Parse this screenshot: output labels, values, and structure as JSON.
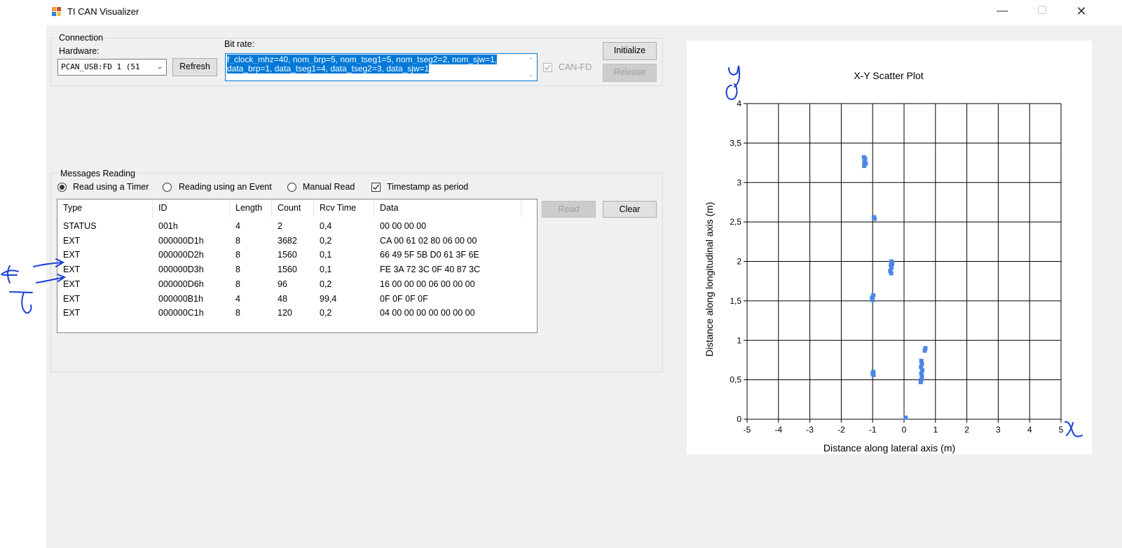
{
  "window": {
    "title": "TI CAN Visualizer"
  },
  "connection": {
    "group_title": "Connection",
    "hardware_label": "Hardware:",
    "hardware_value": "PCAN_USB:FD 1 (51",
    "refresh_label": "Refresh",
    "bitrate_label": "Bit rate:",
    "bitrate_line1": "f_clock_mhz=40, nom_brp=5, nom_tseg1=5, nom_tseg2=2, nom_sjw=1,",
    "bitrate_line2": "data_brp=1, data_tseg1=4, data_tseg2=3, data_sjw=1",
    "canfd_label": "CAN-FD",
    "canfd_checked": true,
    "initialize_label": "Initialize",
    "release_label": "Release"
  },
  "messages": {
    "group_title": "Messages Reading",
    "radio_timer": "Read using a Timer",
    "radio_event": "Reading using an Event",
    "radio_manual": "Manual Read",
    "selected_mode": "timer",
    "timestamp_label": "Timestamp as period",
    "timestamp_checked": true,
    "read_label": "Read",
    "clear_label": "Clear",
    "columns": [
      "Type",
      "ID",
      "Length",
      "Count",
      "Rcv Time",
      "Data"
    ],
    "rows": [
      [
        "STATUS",
        "001h",
        "4",
        "2",
        "0,4",
        "00 00 00 00"
      ],
      [
        "EXT",
        "000000D1h",
        "8",
        "3682",
        "0,2",
        "CA 00 61 02 80 06 00 00"
      ],
      [
        "EXT",
        "000000D2h",
        "8",
        "1560",
        "0,1",
        "66 49 5F 5B D0 61 3F 6E"
      ],
      [
        "EXT",
        "000000D3h",
        "8",
        "1560",
        "0,1",
        "FE 3A 72 3C 0F 40 87 3C"
      ],
      [
        "EXT",
        "000000D6h",
        "8",
        "96",
        "0,2",
        "16 00 00 00 06 00 00 00"
      ],
      [
        "EXT",
        "000000B1h",
        "4",
        "48",
        "99,4",
        "0F 0F 0F 0F"
      ],
      [
        "EXT",
        "000000C1h",
        "8",
        "120",
        "0,2",
        "04 00 00 00 00 00 00 00"
      ]
    ]
  },
  "chart_data": {
    "type": "scatter",
    "title": "X-Y Scatter Plot",
    "xlabel": "Distance along lateral axis (m)",
    "ylabel": "Distance along longitudinal axis (m)",
    "xlim": [
      -5,
      5
    ],
    "ylim": [
      0,
      4
    ],
    "xticks": [
      "-5",
      "-4",
      "-3",
      "-2",
      "-1",
      "0",
      "1",
      "2",
      "3",
      "4",
      "5"
    ],
    "yticks": [
      "0",
      "0,5",
      "1",
      "1,5",
      "2",
      "2,5",
      "3",
      "3,5",
      "4"
    ],
    "grid": true,
    "marker_color": "#4a86e8",
    "points": [
      [
        -1.28,
        3.32
      ],
      [
        -1.24,
        3.3
      ],
      [
        -1.26,
        3.26
      ],
      [
        -1.22,
        3.24
      ],
      [
        -1.27,
        3.21
      ],
      [
        -0.96,
        2.56
      ],
      [
        -0.94,
        2.54
      ],
      [
        -0.4,
        2.0
      ],
      [
        -0.38,
        1.97
      ],
      [
        -0.42,
        1.95
      ],
      [
        -0.4,
        1.92
      ],
      [
        -0.44,
        1.88
      ],
      [
        -0.41,
        1.85
      ],
      [
        -0.98,
        1.57
      ],
      [
        -1.02,
        1.54
      ],
      [
        -1.0,
        1.51
      ],
      [
        -0.98,
        0.6
      ],
      [
        -1.0,
        0.58
      ],
      [
        -0.97,
        0.56
      ],
      [
        0.68,
        0.9
      ],
      [
        0.66,
        0.87
      ],
      [
        0.55,
        0.74
      ],
      [
        0.57,
        0.7
      ],
      [
        0.54,
        0.66
      ],
      [
        0.58,
        0.62
      ],
      [
        0.55,
        0.58
      ],
      [
        0.57,
        0.54
      ],
      [
        0.55,
        0.5
      ],
      [
        0.53,
        0.47
      ],
      [
        0.05,
        0.02
      ]
    ]
  },
  "annotations": {
    "y_axis_note": "y",
    "x_axis_note": "x",
    "left_note": "f",
    "color": "#1a3fd6"
  }
}
